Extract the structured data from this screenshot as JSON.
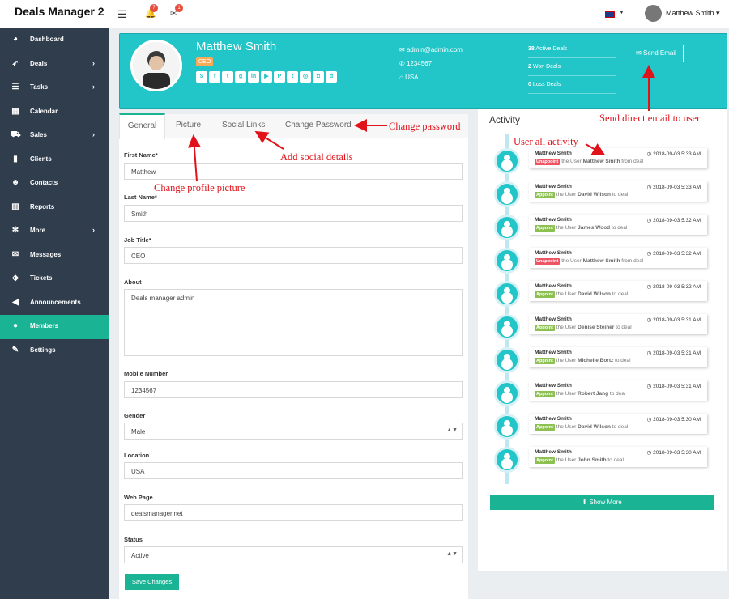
{
  "header": {
    "brand": "Deals Manager 2",
    "menu_icon": "menu-icon",
    "notifications_count": "7",
    "messages_count": "1",
    "flag_icon": "uk-flag-icon",
    "user_name": "Matthew Smith",
    "user_caret": "▾"
  },
  "sidebar": {
    "items": [
      {
        "label": "Dashboard",
        "icon": "dashboard-icon",
        "glyph": "◕",
        "chevron": ""
      },
      {
        "label": "Deals",
        "icon": "rocket-icon",
        "glyph": "➶",
        "chevron": "›"
      },
      {
        "label": "Tasks",
        "icon": "tasks-icon",
        "glyph": "☰",
        "chevron": "›"
      },
      {
        "label": "Calendar",
        "icon": "calendar-icon",
        "glyph": "▦",
        "chevron": ""
      },
      {
        "label": "Sales",
        "icon": "cart-icon",
        "glyph": "⛟",
        "chevron": "›"
      },
      {
        "label": "Clients",
        "icon": "building-icon",
        "glyph": "▮",
        "chevron": ""
      },
      {
        "label": "Contacts",
        "icon": "users-icon",
        "glyph": "☻",
        "chevron": ""
      },
      {
        "label": "Reports",
        "icon": "chart-icon",
        "glyph": "▥",
        "chevron": ""
      },
      {
        "label": "More",
        "icon": "cog-icon",
        "glyph": "✻",
        "chevron": "›"
      },
      {
        "label": "Messages",
        "icon": "envelope-icon",
        "glyph": "✉",
        "chevron": ""
      },
      {
        "label": "Tickets",
        "icon": "tag-icon",
        "glyph": "⬗",
        "chevron": ""
      },
      {
        "label": "Announcements",
        "icon": "bullhorn-icon",
        "glyph": "◀",
        "chevron": ""
      },
      {
        "label": "Members",
        "icon": "user-icon",
        "glyph": "●",
        "chevron": ""
      },
      {
        "label": "Settings",
        "icon": "wrench-icon",
        "glyph": "✎",
        "chevron": ""
      }
    ],
    "active": "Members"
  },
  "profile": {
    "name": "Matthew Smith",
    "role": "CEO",
    "social": [
      {
        "icon": "skype-icon",
        "glyph": "S"
      },
      {
        "icon": "facebook-icon",
        "glyph": "f"
      },
      {
        "icon": "twitter-icon",
        "glyph": "t"
      },
      {
        "icon": "google-plus-icon",
        "glyph": "g"
      },
      {
        "icon": "linkedin-icon",
        "glyph": "in"
      },
      {
        "icon": "youtube-icon",
        "glyph": "▶"
      },
      {
        "icon": "pinterest-icon",
        "glyph": "P"
      },
      {
        "icon": "tumblr-icon",
        "glyph": "t"
      },
      {
        "icon": "github-icon",
        "glyph": "◎"
      },
      {
        "icon": "instagram-icon",
        "glyph": "◘"
      },
      {
        "icon": "digg-icon",
        "glyph": "d"
      }
    ],
    "email": "admin@admin.com",
    "phone": "1234567",
    "country": "USA",
    "stats": [
      {
        "value": "38",
        "label": "Active Deals"
      },
      {
        "value": "2",
        "label": "Won Deals"
      },
      {
        "value": "0",
        "label": "Loss Deals"
      }
    ],
    "send_email_label": "Send Email"
  },
  "tabs": [
    {
      "label": "General"
    },
    {
      "label": "Picture"
    },
    {
      "label": "Social Links"
    },
    {
      "label": "Change Password"
    }
  ],
  "form": {
    "first_name_label": "First Name*",
    "first_name": "Matthew",
    "last_name_label": "Last Name*",
    "last_name": "Smith",
    "job_title_label": "Job Title*",
    "job_title": "CEO",
    "about_label": "About",
    "about": "Deals manager admin",
    "mobile_label": "Mobile Number",
    "mobile": "1234567",
    "gender_label": "Gender",
    "gender": "Male",
    "location_label": "Location",
    "location": "USA",
    "web_label": "Web Page",
    "web": "dealsmanager.net",
    "status_label": "Status",
    "status": "Active",
    "save_label": "Save Changes"
  },
  "activity": {
    "title": "Activity",
    "show_more": "Show More",
    "items": [
      {
        "user": "Matthew Smith",
        "time": "2018-09-03 5:33 AM",
        "badge": "Unappoint",
        "badge_color": "#ed5565",
        "prefix": "the User",
        "target": "Matthew Smith",
        "suffix": "from deal"
      },
      {
        "user": "Matthew Smith",
        "time": "2018-09-03 5:33 AM",
        "badge": "Appoint",
        "badge_color": "#8cc152",
        "prefix": "the User",
        "target": "David Wilson",
        "suffix": "to deal"
      },
      {
        "user": "Matthew Smith",
        "time": "2018-09-03 5:32 AM",
        "badge": "Appoint",
        "badge_color": "#8cc152",
        "prefix": "the User",
        "target": "James Wood",
        "suffix": "to deal"
      },
      {
        "user": "Matthew Smith",
        "time": "2018-09-03 5:32 AM",
        "badge": "Unappoint",
        "badge_color": "#ed5565",
        "prefix": "the User",
        "target": "Matthew Smith",
        "suffix": "from deal"
      },
      {
        "user": "Matthew Smith",
        "time": "2018-09-03 5:32 AM",
        "badge": "Appoint",
        "badge_color": "#8cc152",
        "prefix": "the User",
        "target": "David Wilson",
        "suffix": "to deal"
      },
      {
        "user": "Matthew Smith",
        "time": "2018-09-03 5:31 AM",
        "badge": "Appoint",
        "badge_color": "#8cc152",
        "prefix": "the User",
        "target": "Denise Steiner",
        "suffix": "to deal"
      },
      {
        "user": "Matthew Smith",
        "time": "2018-09-03 5:31 AM",
        "badge": "Appoint",
        "badge_color": "#8cc152",
        "prefix": "the User",
        "target": "Michelle Bortz",
        "suffix": "to deal"
      },
      {
        "user": "Matthew Smith",
        "time": "2018-09-03 5:31 AM",
        "badge": "Appoint",
        "badge_color": "#8cc152",
        "prefix": "the User",
        "target": "Robert Jang",
        "suffix": "to deal"
      },
      {
        "user": "Matthew Smith",
        "time": "2018-09-03 5:30 AM",
        "badge": "Appoint",
        "badge_color": "#8cc152",
        "prefix": "the User",
        "target": "David Wilson",
        "suffix": "to deal"
      },
      {
        "user": "Matthew Smith",
        "time": "2018-09-03 5:30 AM",
        "badge": "Appoint",
        "badge_color": "#8cc152",
        "prefix": "the User",
        "target": "John Smith",
        "suffix": "to deal"
      }
    ]
  },
  "annotations": {
    "send_email": "Send direct email to user",
    "change_password": "Change password",
    "social": "Add social details",
    "picture": "Change profile picture",
    "activity": "User all activity"
  }
}
